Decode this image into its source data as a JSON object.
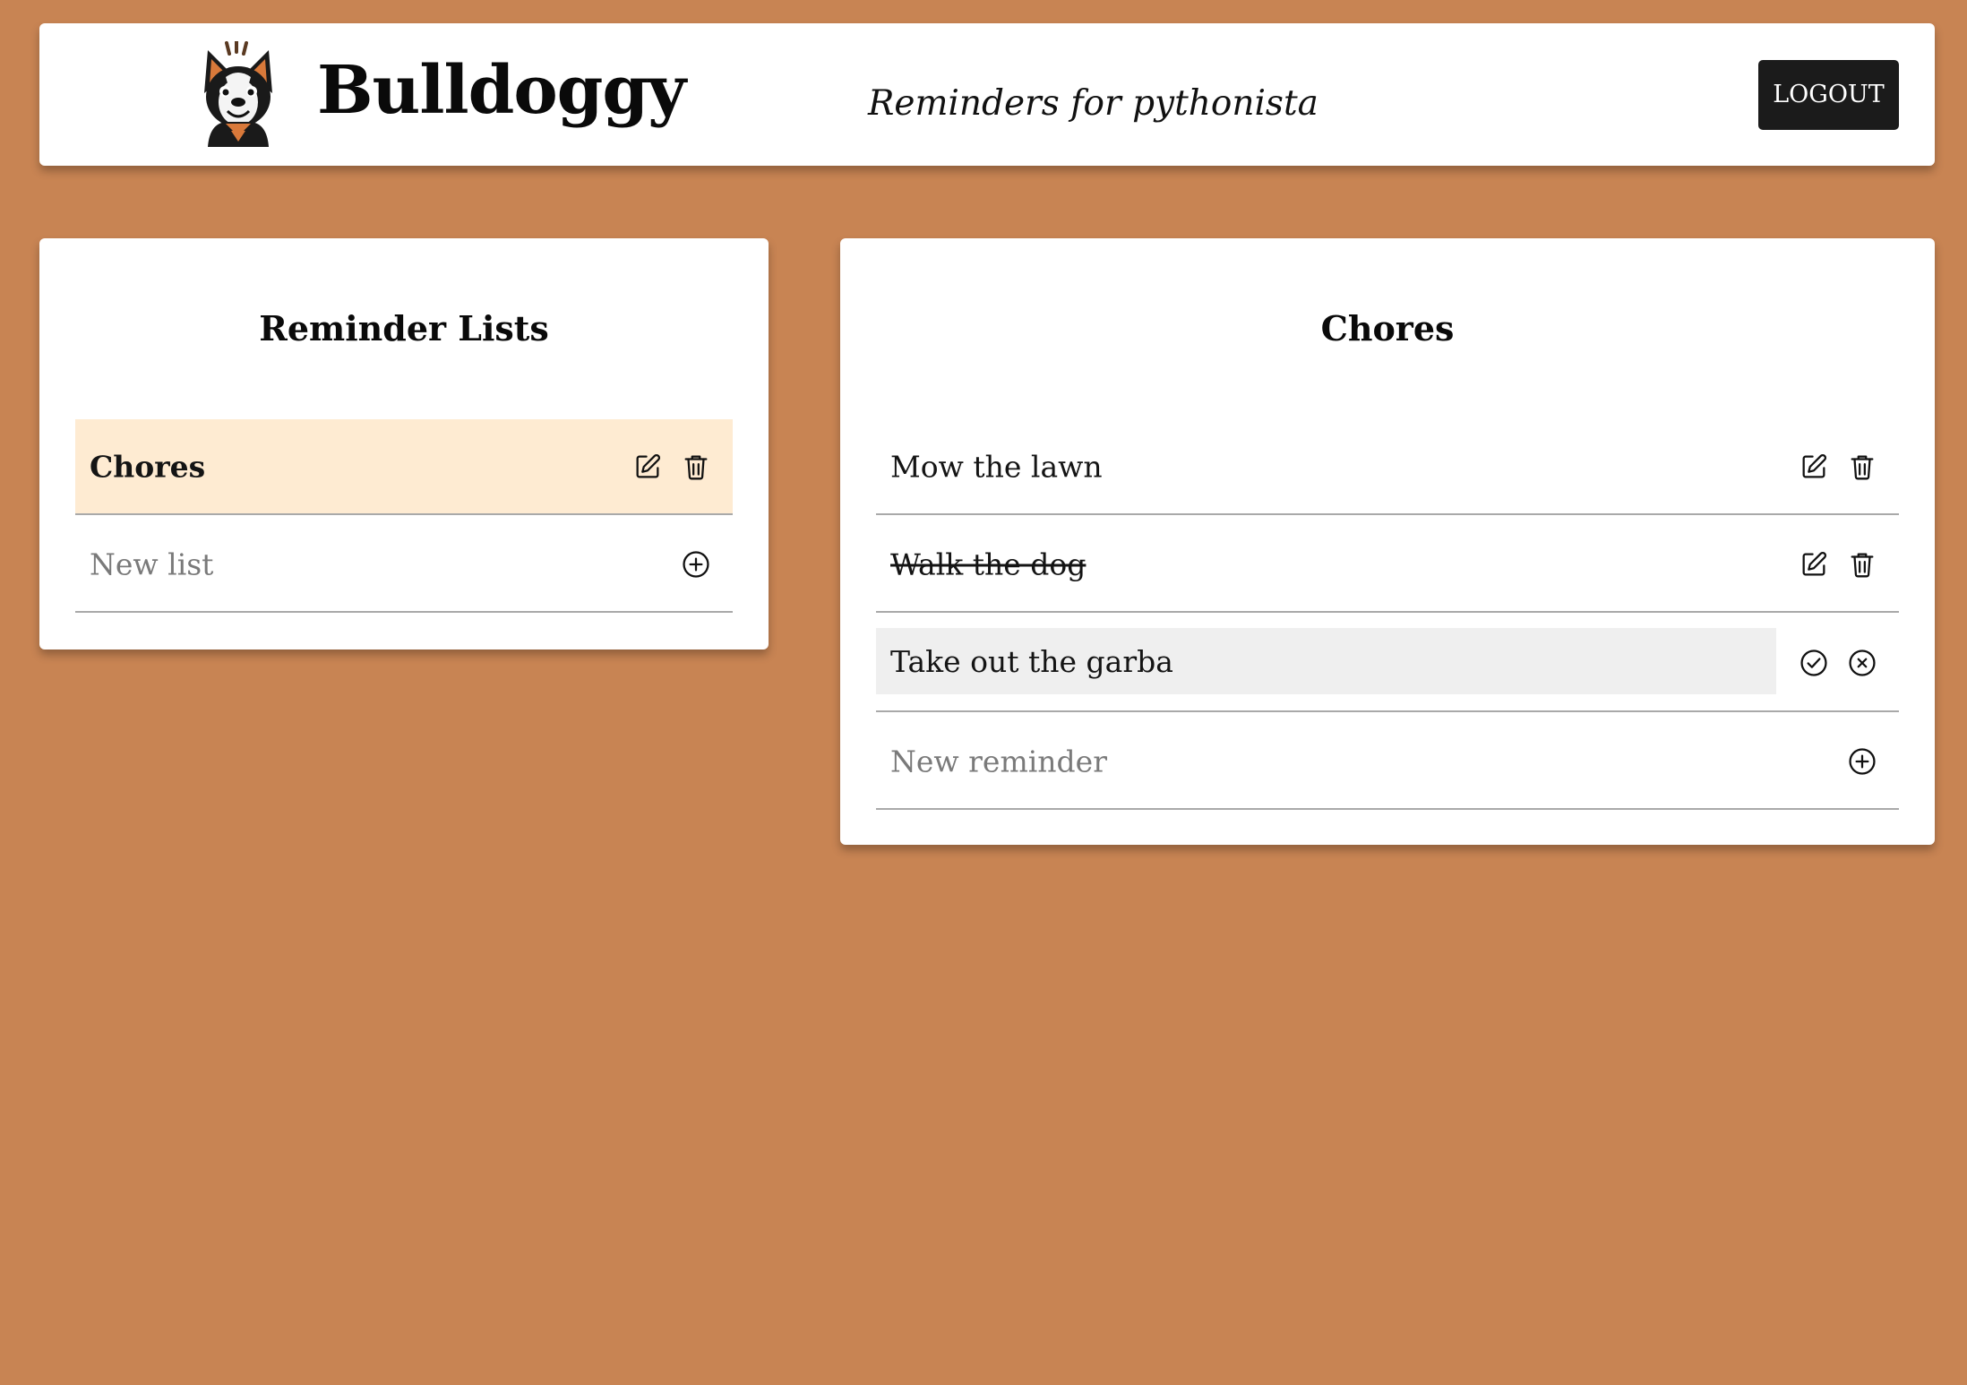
{
  "header": {
    "app_name": "Bulldoggy",
    "tagline": "Reminders for pythonista",
    "logout_label": "LOGOUT"
  },
  "lists_panel": {
    "title": "Reminder Lists",
    "items": [
      {
        "label": "Chores",
        "selected": true
      }
    ],
    "new_placeholder": "New list"
  },
  "reminders_panel": {
    "title": "Chores",
    "items": [
      {
        "label": "Mow the lawn",
        "completed": false
      },
      {
        "label": "Walk the dog",
        "completed": true
      }
    ],
    "editing_value": "Take out the garba",
    "new_placeholder": "New reminder"
  },
  "colors": {
    "background": "#C88453",
    "selected_row": "#FEEBD2",
    "button_dark": "#1B1B1B",
    "edit_field": "#EFEFEF"
  },
  "icons": {
    "edit": "edit-icon",
    "delete": "trash-icon",
    "add": "plus-circle-icon",
    "confirm": "check-circle-icon",
    "cancel": "x-circle-icon",
    "logo": "bulldog-logo"
  }
}
